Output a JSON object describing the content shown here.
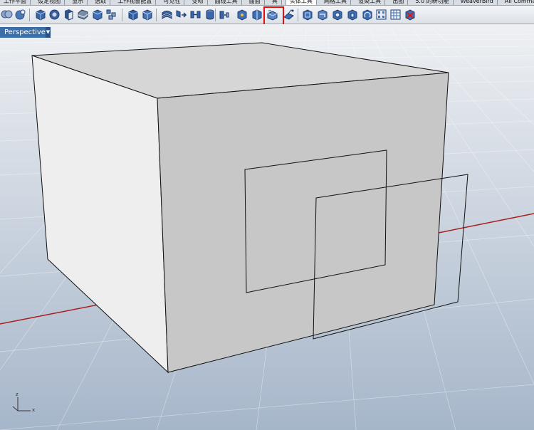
{
  "tabs": [
    {
      "label": "工作平面"
    },
    {
      "label": "设定视图"
    },
    {
      "label": "显示"
    },
    {
      "label": "选取"
    },
    {
      "label": "工作视窗配置"
    },
    {
      "label": "可见性"
    },
    {
      "label": "变动"
    },
    {
      "label": "曲线工具"
    },
    {
      "label": "曲面"
    },
    {
      "label": "具"
    },
    {
      "label": "实体工具"
    },
    {
      "label": "网格工具"
    },
    {
      "label": "渲染工具"
    },
    {
      "label": "出图"
    },
    {
      "label": "5.0 的新功能"
    },
    {
      "label": "WeaverBird"
    },
    {
      "label": "All Commands"
    }
  ],
  "active_tab": "实体工具",
  "viewport": {
    "name": "Perspective",
    "dropdown_glyph": "▼"
  },
  "axes": {
    "x": "x",
    "z": "z"
  },
  "colors": {
    "viewport_bg_top": "#e9ecf0",
    "viewport_bg_bottom": "#a3b4c8",
    "grid": "#cfd5dc",
    "x_axis": "#a81e1e",
    "box_front": "#c8c7c8",
    "box_left": "#ededed",
    "box_top": "#d9d8d8",
    "highlight": "#e01010"
  }
}
